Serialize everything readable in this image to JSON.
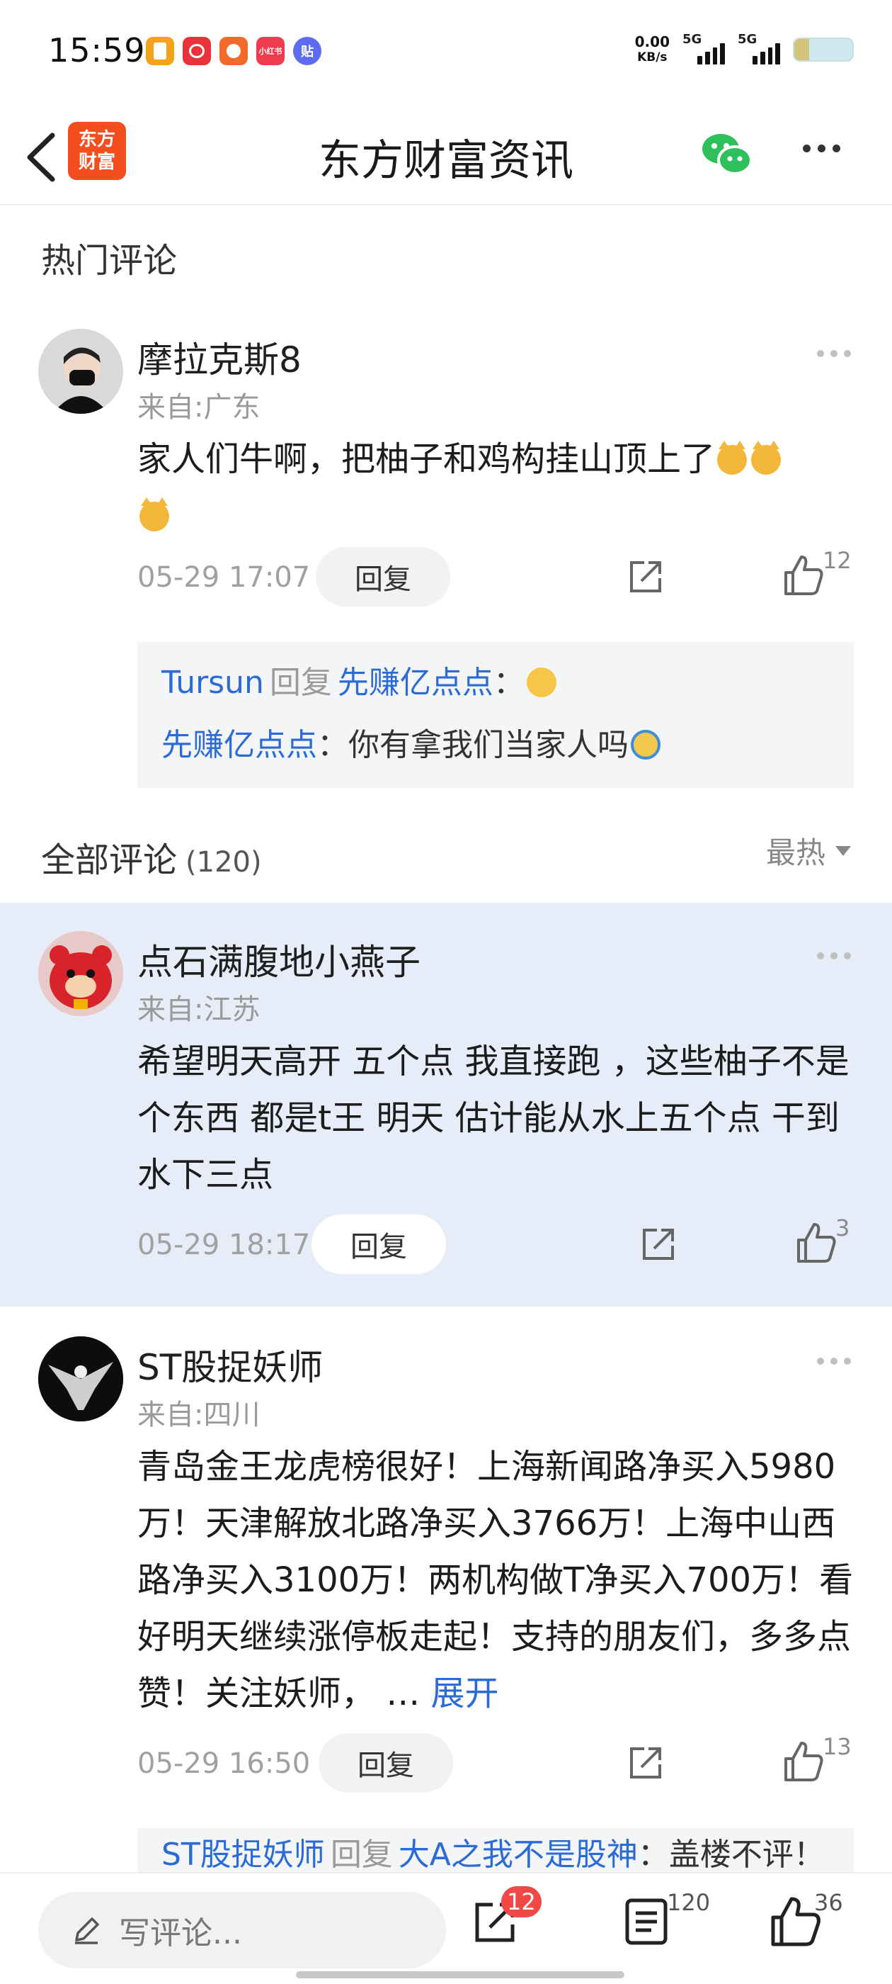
{
  "status_bar": {
    "time": "15:59",
    "net_speed_value": "0.00",
    "net_speed_unit": "KB/s",
    "signal1": "5G",
    "signal2": "5G",
    "battery_level": 0.25,
    "app_icons": [
      {
        "name": "notes-app-icon",
        "color": "#f4a21b",
        "text": ""
      },
      {
        "name": "brand-app-icon",
        "color": "#e8333b",
        "text": ""
      },
      {
        "name": "taobao-app-icon",
        "color": "#f36b2b",
        "text": ""
      },
      {
        "name": "xiaohongshu-app-icon",
        "color": "#f03a4f",
        "text": "小红书"
      },
      {
        "name": "tieba-app-icon",
        "color": "#5b6cf1",
        "text": "贴"
      }
    ]
  },
  "header": {
    "logo_line1": "东方",
    "logo_line2": "财富",
    "title": "东方财富资讯"
  },
  "hot_section": {
    "title": "热门评论"
  },
  "all_section": {
    "title": "全部评论",
    "count": "(120)",
    "sort_label": "最热"
  },
  "comments": [
    {
      "username": "摩拉克斯8",
      "region": "来自:广东",
      "text": "家人们牛啊，把柚子和鸡构挂山顶上了",
      "date": "05-29 17:07",
      "reply_label": "回复",
      "likes": "12",
      "replies": [
        {
          "user": "Tursun",
          "verb": "回复",
          "target": "先赚亿点点",
          "text": "："
        },
        {
          "user": "先赚亿点点",
          "verb": "",
          "target": "",
          "text": "：你有拿我们当家人吗"
        }
      ]
    },
    {
      "username": "点石满腹地小燕子",
      "region": "来自:江苏",
      "text": "希望明天高开  五个点 我直接跑 ，这些柚子不是个东西  都是t王  明天 估计能从水上五个点 干到水下三点",
      "date": "05-29 18:17",
      "reply_label": "回复",
      "likes": "3"
    },
    {
      "username": "ST股捉妖师",
      "region": "来自:四川",
      "text": "青岛金王龙虎榜很好！上海新闻路净买入5980万！天津解放北路净买入3766万！上海中山西路净买入3100万！两机构做T净买入700万！看好明天继续涨停板走起！支持的朋友们，多多点赞！关注妖师，  …",
      "expand_label": "展开",
      "date": "05-29 16:50",
      "reply_label": "回复",
      "likes": "13",
      "partial_reply": {
        "user": "ST股捉妖师",
        "verb": "回复",
        "target": "大A之我不是股神",
        "text": "：盖楼不评！"
      }
    }
  ],
  "bottom_bar": {
    "write_placeholder": "写评论...",
    "share_badge": "12",
    "comment_count": "120",
    "like_count": "36"
  }
}
